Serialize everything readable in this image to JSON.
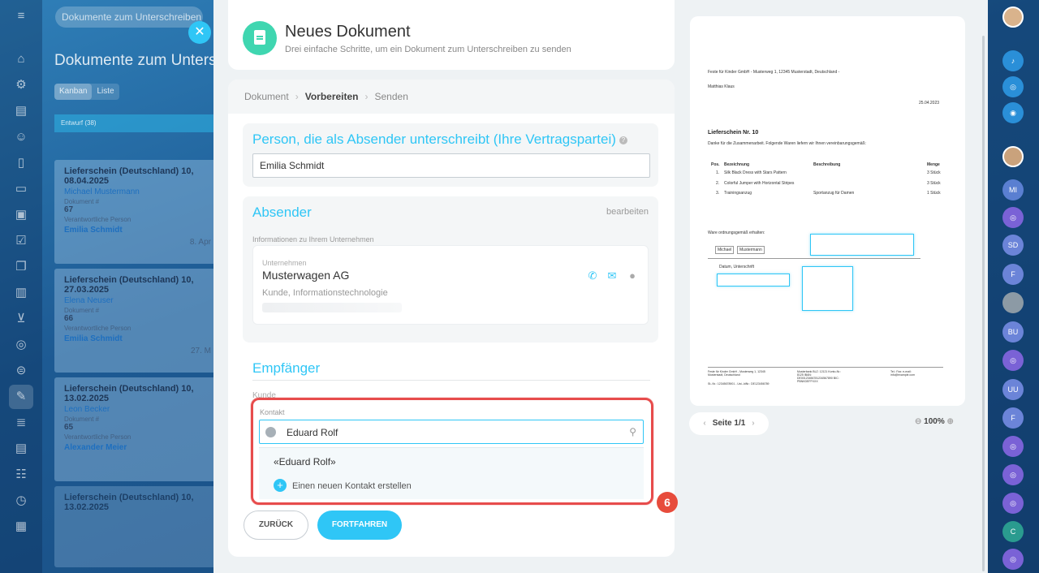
{
  "background": {
    "search_text": "Dokumente zum Unterschreiben",
    "page_title": "Dokumente zum Unters",
    "view_tabs": [
      "Kanban",
      "Liste"
    ],
    "column_label": "Entwurf (38)",
    "cards": [
      {
        "title": "Lieferschein (Deutschland) 10, 08.04.2025",
        "name": "Michael Mustermann",
        "doc_label": "Dokument #",
        "doc_no": "67",
        "resp_label": "Verantwortliche Person",
        "person": "Emilia Schmidt",
        "date": "8. Apr"
      },
      {
        "title": "Lieferschein (Deutschland) 10, 27.03.2025",
        "name": "Elena Neuser",
        "doc_label": "Dokument #",
        "doc_no": "66",
        "resp_label": "Verantwortliche Person",
        "person": "Emilia Schmidt",
        "date": "27. M"
      },
      {
        "title": "Lieferschein (Deutschland) 10, 13.02.2025",
        "name": "Leon Becker",
        "doc_label": "Dokument #",
        "doc_no": "65",
        "resp_label": "Verantwortliche Person",
        "person": "Alexander Meier",
        "date": ""
      },
      {
        "title": "Lieferschein (Deutschland) 10, 13.02.2025",
        "name": "",
        "doc_label": "",
        "doc_no": "",
        "resp_label": "",
        "person": "",
        "date": ""
      }
    ]
  },
  "header": {
    "title": "Neues Dokument",
    "subtitle": "Drei einfache Schritte, um ein Dokument zum Unterschreiben zu senden"
  },
  "steps": [
    "Dokument",
    "Vorbereiten",
    "Senden"
  ],
  "sender_signer": {
    "title": "Person, die als Absender unterschreibt (Ihre Vertragspartei)",
    "value": "Emilia Schmidt"
  },
  "sender": {
    "title": "Absender",
    "edit": "bearbeiten",
    "info_label": "Informationen zu Ihrem Unternehmen",
    "company_label": "Unternehmen",
    "company_name": "Musterwagen AG",
    "company_sub": "Kunde, Informationstechnologie"
  },
  "recipient": {
    "title": "Empfänger",
    "kunde_label": "Kunde",
    "kontakt_label": "Kontakt",
    "kontakt_value": "Eduard Rolf",
    "suggestion": "«Eduard Rolf»",
    "create_new": "Einen neuen Kontakt erstellen"
  },
  "annotation_badge": "6",
  "buttons": {
    "back": "ZURÜCK",
    "next": "FORTFAHREN"
  },
  "preview": {
    "sender_line": "Feste für Kinder GmbH - Musterweg 1, 12345 Musterstadt, Deutschland -",
    "recipient": "Matthias Klaus",
    "date": "25.04.2023",
    "title": "Lieferschein Nr. 10",
    "intro": "Danke für die Zusammenarbeit. Folgende Waren liefern wir Ihnen vereinbarungsgemäß:",
    "columns": [
      "Pos.",
      "Bezeichnung",
      "Beschreibung",
      "Menge"
    ],
    "rows": [
      [
        "1.",
        "Silk Black Dress with Stars Pattern",
        "",
        "3 Stück"
      ],
      [
        "2.",
        "Colorful Jumper with Horizontal Stripes",
        "",
        "3 Stück"
      ],
      [
        "3.",
        "Trainingsanzug",
        "Sportanzug für Damen",
        "1 Stück"
      ]
    ],
    "received_label": "Ware ordnungsgemäß erhalten:",
    "name_first": "Michael",
    "name_last": "Mustermann",
    "date_sign_label": "Datum, Unterschrift",
    "footer_col1": "Feste für Kinder GmbH - Musterweg 1, 12345 Musterstadt, Deutschland",
    "footer_col1b": "St.-Nr.: 12345678901 - Ust.-IdNr.: DE123456789",
    "footer_col2": "Musterbank BLZ: 12121 Konto-Nr.: 8125 IBAN: DE00123456781234567890 BIC: PBNKDEFFXXX",
    "footer_col3": "Tel.: Fax: e-mail: info@example.com",
    "page": "Seite 1/1",
    "zoom": "100%"
  }
}
